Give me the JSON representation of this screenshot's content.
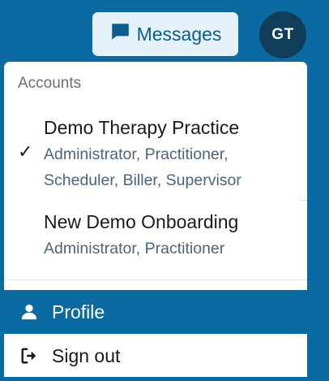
{
  "header": {
    "messages_label": "Messages",
    "avatar_initials": "GT"
  },
  "menu": {
    "heading": "Accounts",
    "accounts": [
      {
        "name": "Demo Therapy Practice",
        "roles_line1": "Administrator, Practitioner,",
        "roles_line2": "Scheduler, Biller, Supervisor",
        "selected": true
      },
      {
        "name": "New Demo Onboarding",
        "roles_line1": "Administrator, Practitioner",
        "selected": false
      }
    ],
    "check_glyph": "✓",
    "items": [
      {
        "label": "Profile",
        "icon": "user-icon",
        "active": true
      },
      {
        "label": "Sign out",
        "icon": "sign-out-icon",
        "active": false
      }
    ]
  },
  "colors": {
    "brand": "#0a6aa1",
    "avatar_bg": "#0f3d5a",
    "messages_bg": "#e6f2fa"
  }
}
